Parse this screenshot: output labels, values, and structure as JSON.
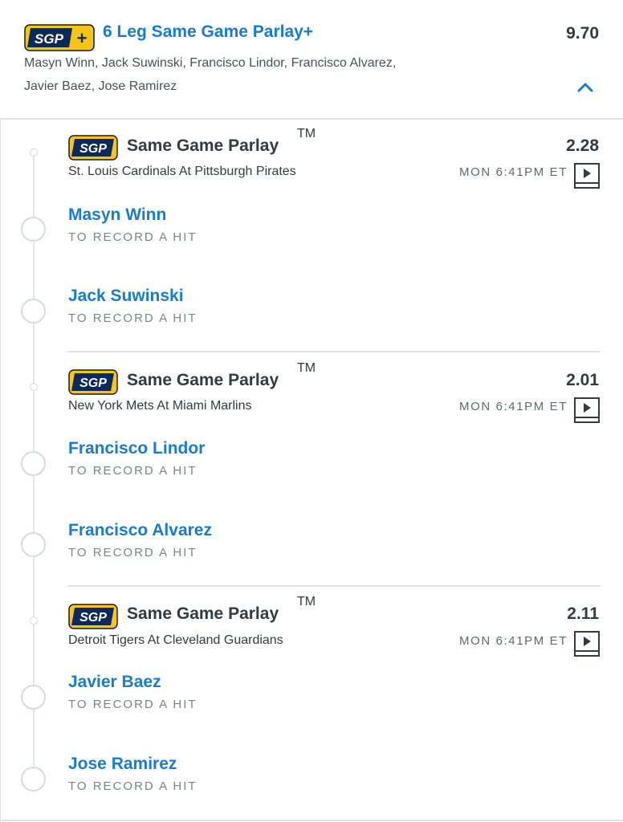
{
  "header": {
    "badge_text": "SGP",
    "badge_plus": "+",
    "title": "6 Leg Same Game Parlay+",
    "odds": "9.70",
    "legs_line1": "Masyn Winn, Jack Suwinski, Francisco Lindor, Francisco Alvarez,",
    "legs_line2": "Javier Baez, Jose Ramirez",
    "collapse_icon": "chevron-up-icon"
  },
  "groups": [
    {
      "badge_text": "SGP",
      "title": "Same Game Parlay",
      "tm": "TM",
      "odds": "2.28",
      "match": "St. Louis Cardinals At Pittsburgh Pirates",
      "time": "MON 6:41PM ET",
      "legs": [
        {
          "name": "Masyn Winn",
          "market": "TO RECORD A HIT"
        },
        {
          "name": "Jack Suwinski",
          "market": "TO RECORD A HIT"
        }
      ]
    },
    {
      "badge_text": "SGP",
      "title": "Same Game Parlay",
      "tm": "TM",
      "odds": "2.01",
      "match": "New York Mets At Miami Marlins",
      "time": "MON 6:41PM ET",
      "legs": [
        {
          "name": "Francisco Lindor",
          "market": "TO RECORD A HIT"
        },
        {
          "name": "Francisco Alvarez",
          "market": "TO RECORD A HIT"
        }
      ]
    },
    {
      "badge_text": "SGP",
      "title": "Same Game Parlay",
      "tm": "TM",
      "odds": "2.11",
      "match": "Detroit Tigers At Cleveland Guardians",
      "time": "MON 6:41PM ET",
      "legs": [
        {
          "name": "Javier Baez",
          "market": "TO RECORD A HIT"
        },
        {
          "name": "Jose Ramirez",
          "market": "TO RECORD A HIT"
        }
      ]
    }
  ],
  "colors": {
    "accent_blue": "#1a7cd1",
    "badge_navy": "#0b2a5b",
    "badge_gold": "#f5c518",
    "text_dark": "#333b42",
    "text_muted": "#7a858d"
  }
}
